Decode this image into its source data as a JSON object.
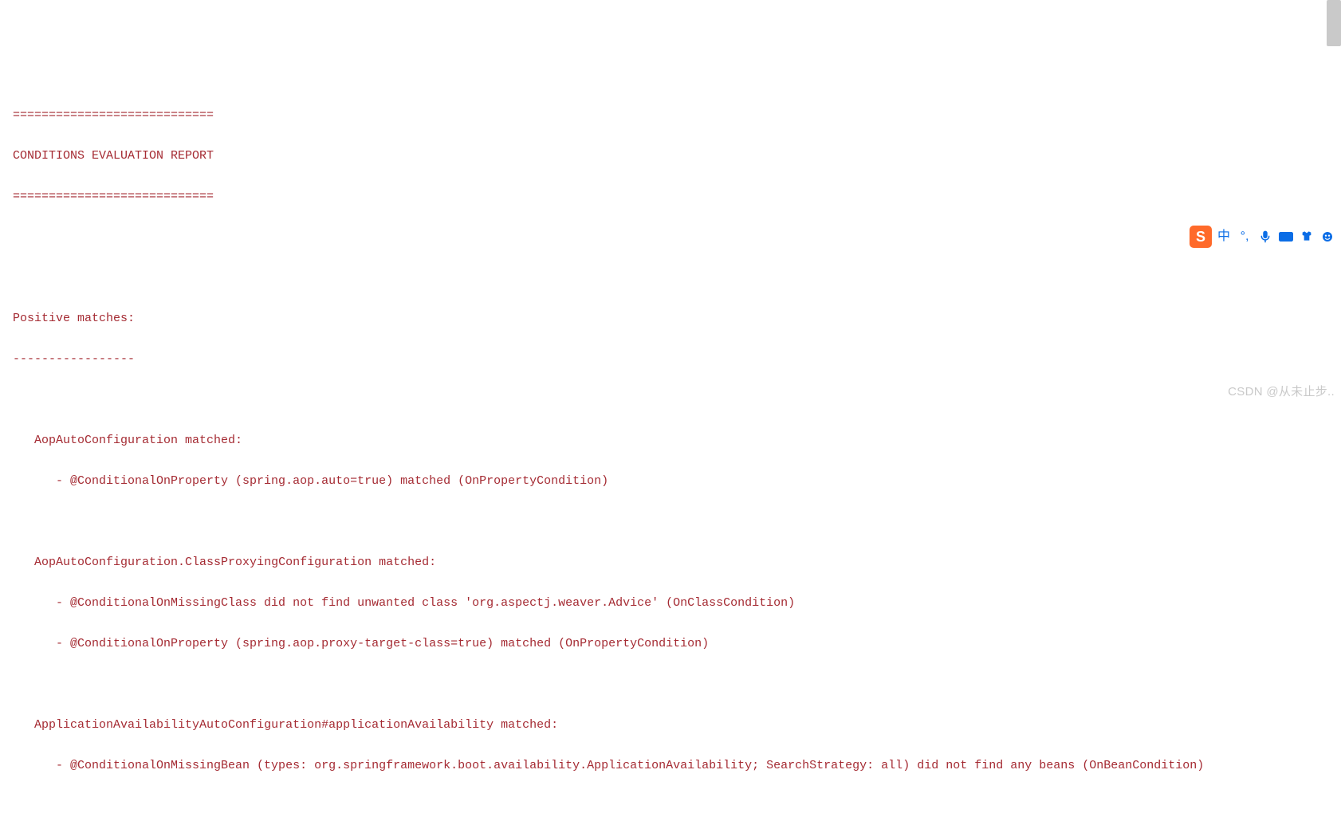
{
  "report": {
    "hr": "============================",
    "title": "CONDITIONS EVALUATION REPORT",
    "positive_header": "Positive matches:",
    "positive_underline": "-----------------",
    "matches": [
      {
        "name": "AopAutoConfiguration matched:",
        "reasons": [
          "- @ConditionalOnProperty (spring.aop.auto=true) matched (OnPropertyCondition)"
        ]
      },
      {
        "name": "AopAutoConfiguration.ClassProxyingConfiguration matched:",
        "reasons": [
          "- @ConditionalOnMissingClass did not find unwanted class 'org.aspectj.weaver.Advice' (OnClassCondition)",
          "- @ConditionalOnProperty (spring.aop.proxy-target-class=true) matched (OnPropertyCondition)"
        ]
      },
      {
        "name": "ApplicationAvailabilityAutoConfiguration#applicationAvailability matched:",
        "reasons": [
          "- @ConditionalOnMissingBean (types: org.springframework.boot.availability.ApplicationAvailability; SearchStrategy: all) did not find any beans (OnBeanCondition)"
        ]
      }
    ]
  },
  "ime": {
    "logo_letter": "S",
    "lang": "中",
    "icons": {
      "punct": "punct-icon",
      "mic": "mic-icon",
      "keyboard": "keyboard-icon",
      "skin": "skin-icon",
      "tool": "tool-icon"
    }
  },
  "watermark": "CSDN @从未止步.."
}
